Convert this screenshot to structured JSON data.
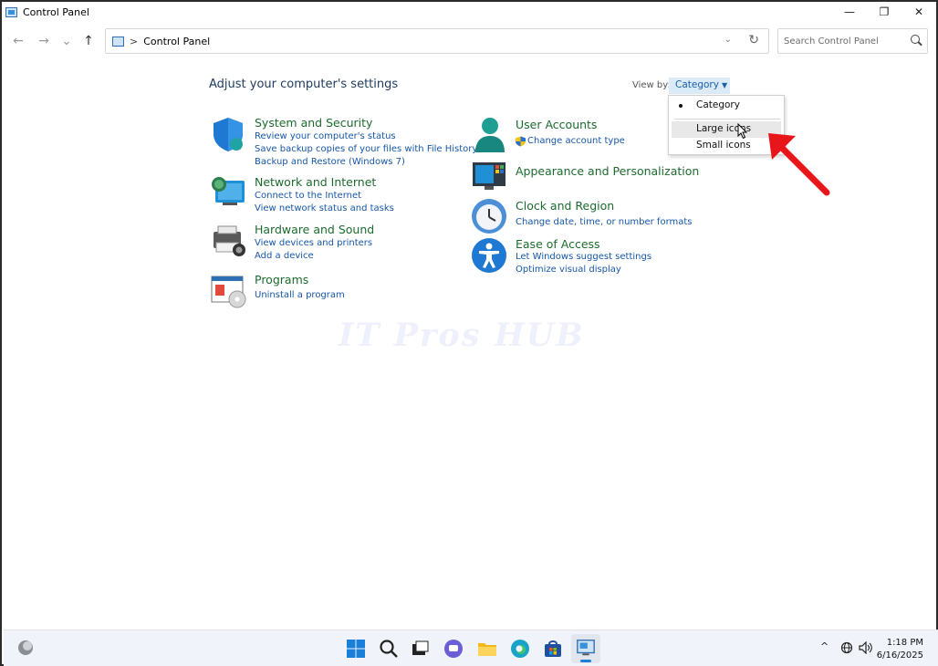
{
  "window": {
    "title": "Control Panel",
    "controls": {
      "minimize": "—",
      "maximize": "❐",
      "close": "✕"
    }
  },
  "nav": {
    "back": "←",
    "forward": "→",
    "recent": "⌄",
    "up": "↑"
  },
  "address": {
    "separator": ">",
    "crumb": "Control Panel",
    "dropdown": "⌄",
    "refresh": "↻"
  },
  "search": {
    "placeholder": "Search Control Panel"
  },
  "heading": "Adjust your computer's settings",
  "view_by": {
    "label": "View by:",
    "selected": "Category",
    "caret": "▼",
    "options": [
      "Category",
      "Large icons",
      "Small icons"
    ],
    "hovered": "Large icons"
  },
  "categories": [
    {
      "id": "system-security",
      "title": "System and Security",
      "links": [
        "Review your computer's status",
        "Save backup copies of your files with File History",
        "Backup and Restore (Windows 7)"
      ]
    },
    {
      "id": "network-internet",
      "title": "Network and Internet",
      "links": [
        "Connect to the Internet",
        "View network status and tasks"
      ]
    },
    {
      "id": "hardware-sound",
      "title": "Hardware and Sound",
      "links": [
        "View devices and printers",
        "Add a device"
      ]
    },
    {
      "id": "programs",
      "title": "Programs",
      "links": [
        "Uninstall a program"
      ]
    },
    {
      "id": "user-accounts",
      "title": "User Accounts",
      "links": [
        "Change account type"
      ]
    },
    {
      "id": "appearance",
      "title": "Appearance and Personalization",
      "links": []
    },
    {
      "id": "clock-region",
      "title": "Clock and Region",
      "links": [
        "Change date, time, or number formats"
      ]
    },
    {
      "id": "ease-access",
      "title": "Ease of Access",
      "links": [
        "Let Windows suggest settings",
        "Optimize visual display"
      ]
    }
  ],
  "watermark": "IT Pros HUB",
  "taskbar": {
    "time": "1:18 PM",
    "date": "6/16/2025",
    "tray_chevron": "^"
  },
  "colors": {
    "title_green": "#1c6b2e",
    "link_blue": "#1657a8",
    "heading_blue": "#1e3a5a",
    "dropdown_bg": "#dbeaf7",
    "arrow_red": "#e8161b"
  }
}
